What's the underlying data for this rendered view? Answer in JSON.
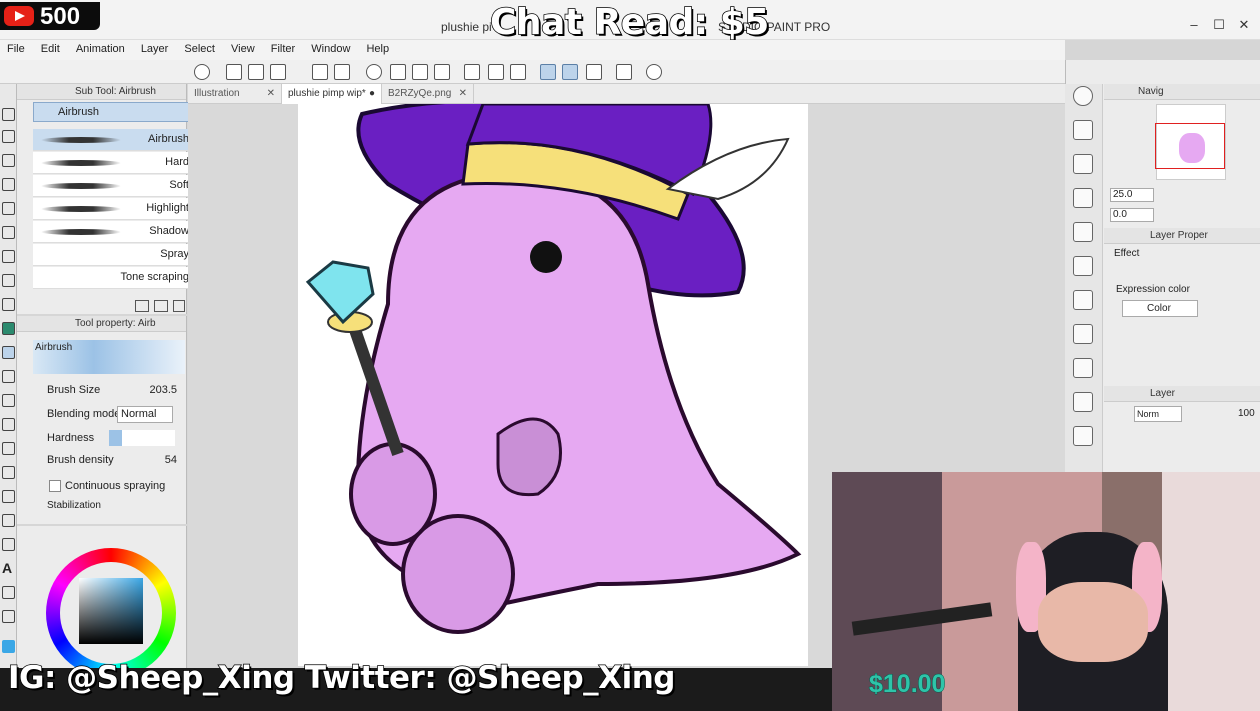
{
  "window": {
    "title_left": "plushie pi",
    "title_right": "STUDIO PAINT PRO"
  },
  "overlay": {
    "yt_count": "500",
    "chat_read": "Chat Read: $5",
    "social": "IG: @Sheep_Xing  Twitter: @Sheep_Xing",
    "donation": "$10.00"
  },
  "menu": [
    "File",
    "Edit",
    "Animation",
    "Layer",
    "Select",
    "View",
    "Filter",
    "Window",
    "Help"
  ],
  "tabs": [
    {
      "label": "Illustration",
      "active": false
    },
    {
      "label": "plushie pimp wip*",
      "active": true
    },
    {
      "label": "B2RZyQe.png",
      "active": false
    }
  ],
  "subtool": {
    "header": "Sub Tool: Airbrush",
    "group": "Airbrush",
    "items": [
      "Airbrush",
      "Hard",
      "Soft",
      "Highlight",
      "Shadow",
      "Spray",
      "Tone scraping"
    ]
  },
  "toolprop": {
    "header": "Tool property: Airb",
    "preview_label": "Airbrush",
    "brush_size_label": "Brush Size",
    "brush_size": "203.5",
    "blending_label": "Blending mode",
    "blending_value": "Normal",
    "hardness_label": "Hardness",
    "density_label": "Brush density",
    "density_value": "54",
    "continuous_label": "Continuous spraying",
    "stabilization_label": "Stabilization"
  },
  "navigator": {
    "header": "Navig",
    "zoom": "25.0",
    "rotate": "0.0"
  },
  "layer_props": {
    "header": "Layer Proper",
    "effect_label": "Effect",
    "expression_label": "Expression color",
    "expression_value": "Color"
  },
  "layer": {
    "header": "Layer",
    "blend": "Norm",
    "opacity": "100"
  },
  "colors": {
    "accent": "#3aa7e6",
    "dino": "#e6a9f2",
    "hat": "#6a1fc2",
    "band": "#f6e07a"
  }
}
